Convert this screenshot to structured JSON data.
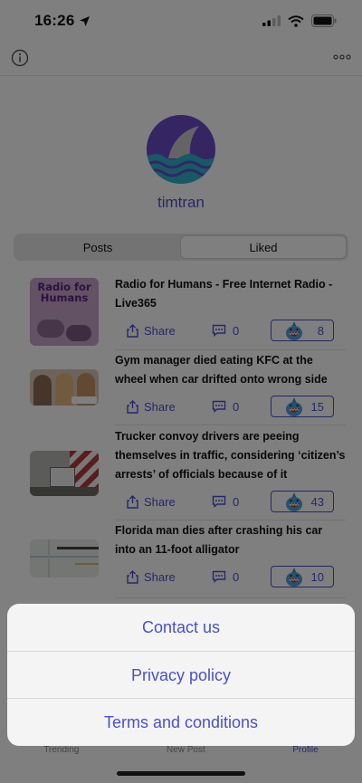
{
  "status_bar": {
    "time": "16:26"
  },
  "profile": {
    "username": "timtran"
  },
  "segment": {
    "posts_label": "Posts",
    "liked_label": "Liked",
    "selected": "Liked"
  },
  "posts": [
    {
      "title": "Radio for Humans - Free Internet Radio - Live365",
      "thumb_text": "Radio for Humans",
      "share_label": "Share",
      "comments": "0",
      "likes": "8"
    },
    {
      "title": "Gym manager died eating KFC at the wheel when car drifted onto wrong side",
      "share_label": "Share",
      "comments": "0",
      "likes": "15"
    },
    {
      "title": "Trucker convoy drivers are peeing themselves in traffic, considering ‘citizen’s arrests’ of officials because of it",
      "share_label": "Share",
      "comments": "0",
      "likes": "43"
    },
    {
      "title": "Florida man dies after crashing his car into an 11-foot alligator",
      "share_label": "Share",
      "comments": "0",
      "likes": "10"
    }
  ],
  "tabbar": {
    "trending": "Trending",
    "new_post": "New Post",
    "profile": "Profile"
  },
  "action_sheet": {
    "contact": "Contact us",
    "privacy": "Privacy policy",
    "terms": "Terms and conditions"
  },
  "colors": {
    "accent": "#4a4fd1",
    "avatar_bg": "#6b4bc7",
    "wave": "#2fb3c9"
  }
}
